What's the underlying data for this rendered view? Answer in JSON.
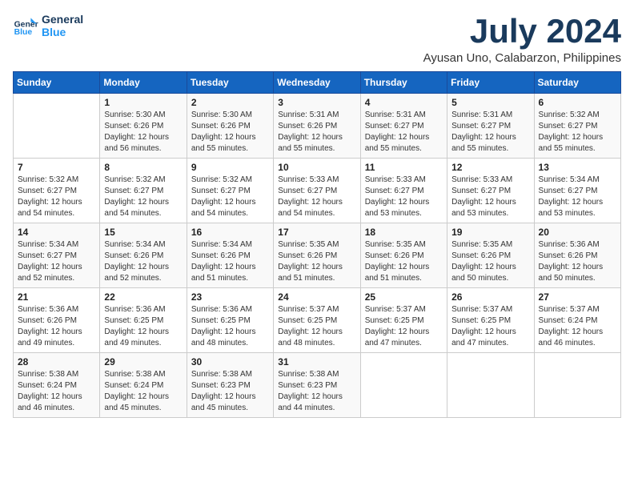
{
  "header": {
    "logo_line1": "General",
    "logo_line2": "Blue",
    "month_year": "July 2024",
    "location": "Ayusan Uno, Calabarzon, Philippines"
  },
  "days_of_week": [
    "Sunday",
    "Monday",
    "Tuesday",
    "Wednesday",
    "Thursday",
    "Friday",
    "Saturday"
  ],
  "weeks": [
    [
      {
        "day": "",
        "info": ""
      },
      {
        "day": "1",
        "info": "Sunrise: 5:30 AM\nSunset: 6:26 PM\nDaylight: 12 hours\nand 56 minutes."
      },
      {
        "day": "2",
        "info": "Sunrise: 5:30 AM\nSunset: 6:26 PM\nDaylight: 12 hours\nand 55 minutes."
      },
      {
        "day": "3",
        "info": "Sunrise: 5:31 AM\nSunset: 6:26 PM\nDaylight: 12 hours\nand 55 minutes."
      },
      {
        "day": "4",
        "info": "Sunrise: 5:31 AM\nSunset: 6:27 PM\nDaylight: 12 hours\nand 55 minutes."
      },
      {
        "day": "5",
        "info": "Sunrise: 5:31 AM\nSunset: 6:27 PM\nDaylight: 12 hours\nand 55 minutes."
      },
      {
        "day": "6",
        "info": "Sunrise: 5:32 AM\nSunset: 6:27 PM\nDaylight: 12 hours\nand 55 minutes."
      }
    ],
    [
      {
        "day": "7",
        "info": "Sunrise: 5:32 AM\nSunset: 6:27 PM\nDaylight: 12 hours\nand 54 minutes."
      },
      {
        "day": "8",
        "info": "Sunrise: 5:32 AM\nSunset: 6:27 PM\nDaylight: 12 hours\nand 54 minutes."
      },
      {
        "day": "9",
        "info": "Sunrise: 5:32 AM\nSunset: 6:27 PM\nDaylight: 12 hours\nand 54 minutes."
      },
      {
        "day": "10",
        "info": "Sunrise: 5:33 AM\nSunset: 6:27 PM\nDaylight: 12 hours\nand 54 minutes."
      },
      {
        "day": "11",
        "info": "Sunrise: 5:33 AM\nSunset: 6:27 PM\nDaylight: 12 hours\nand 53 minutes."
      },
      {
        "day": "12",
        "info": "Sunrise: 5:33 AM\nSunset: 6:27 PM\nDaylight: 12 hours\nand 53 minutes."
      },
      {
        "day": "13",
        "info": "Sunrise: 5:34 AM\nSunset: 6:27 PM\nDaylight: 12 hours\nand 53 minutes."
      }
    ],
    [
      {
        "day": "14",
        "info": "Sunrise: 5:34 AM\nSunset: 6:27 PM\nDaylight: 12 hours\nand 52 minutes."
      },
      {
        "day": "15",
        "info": "Sunrise: 5:34 AM\nSunset: 6:26 PM\nDaylight: 12 hours\nand 52 minutes."
      },
      {
        "day": "16",
        "info": "Sunrise: 5:34 AM\nSunset: 6:26 PM\nDaylight: 12 hours\nand 51 minutes."
      },
      {
        "day": "17",
        "info": "Sunrise: 5:35 AM\nSunset: 6:26 PM\nDaylight: 12 hours\nand 51 minutes."
      },
      {
        "day": "18",
        "info": "Sunrise: 5:35 AM\nSunset: 6:26 PM\nDaylight: 12 hours\nand 51 minutes."
      },
      {
        "day": "19",
        "info": "Sunrise: 5:35 AM\nSunset: 6:26 PM\nDaylight: 12 hours\nand 50 minutes."
      },
      {
        "day": "20",
        "info": "Sunrise: 5:36 AM\nSunset: 6:26 PM\nDaylight: 12 hours\nand 50 minutes."
      }
    ],
    [
      {
        "day": "21",
        "info": "Sunrise: 5:36 AM\nSunset: 6:26 PM\nDaylight: 12 hours\nand 49 minutes."
      },
      {
        "day": "22",
        "info": "Sunrise: 5:36 AM\nSunset: 6:25 PM\nDaylight: 12 hours\nand 49 minutes."
      },
      {
        "day": "23",
        "info": "Sunrise: 5:36 AM\nSunset: 6:25 PM\nDaylight: 12 hours\nand 48 minutes."
      },
      {
        "day": "24",
        "info": "Sunrise: 5:37 AM\nSunset: 6:25 PM\nDaylight: 12 hours\nand 48 minutes."
      },
      {
        "day": "25",
        "info": "Sunrise: 5:37 AM\nSunset: 6:25 PM\nDaylight: 12 hours\nand 47 minutes."
      },
      {
        "day": "26",
        "info": "Sunrise: 5:37 AM\nSunset: 6:25 PM\nDaylight: 12 hours\nand 47 minutes."
      },
      {
        "day": "27",
        "info": "Sunrise: 5:37 AM\nSunset: 6:24 PM\nDaylight: 12 hours\nand 46 minutes."
      }
    ],
    [
      {
        "day": "28",
        "info": "Sunrise: 5:38 AM\nSunset: 6:24 PM\nDaylight: 12 hours\nand 46 minutes."
      },
      {
        "day": "29",
        "info": "Sunrise: 5:38 AM\nSunset: 6:24 PM\nDaylight: 12 hours\nand 45 minutes."
      },
      {
        "day": "30",
        "info": "Sunrise: 5:38 AM\nSunset: 6:23 PM\nDaylight: 12 hours\nand 45 minutes."
      },
      {
        "day": "31",
        "info": "Sunrise: 5:38 AM\nSunset: 6:23 PM\nDaylight: 12 hours\nand 44 minutes."
      },
      {
        "day": "",
        "info": ""
      },
      {
        "day": "",
        "info": ""
      },
      {
        "day": "",
        "info": ""
      }
    ]
  ]
}
